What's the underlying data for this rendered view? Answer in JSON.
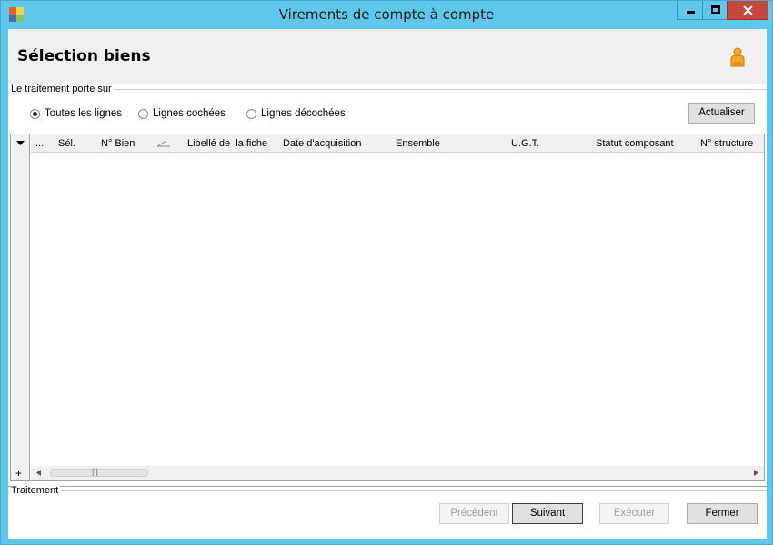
{
  "window": {
    "title": "Virements de compte à compte",
    "icons": {
      "app": "app-icon",
      "minimize": "minimize-icon",
      "maximize": "maximize-icon",
      "close": "close-icon"
    }
  },
  "header": {
    "title": "Sélection biens",
    "user_icon": "user-icon"
  },
  "filter": {
    "group_label": "Le traitement porte sur",
    "options": [
      {
        "label": "Toutes les lignes",
        "selected": true
      },
      {
        "label": "Lignes cochées",
        "selected": false
      },
      {
        "label": "Lignes décochées",
        "selected": false
      }
    ],
    "refresh_label": "Actualiser"
  },
  "grid": {
    "columns": [
      "...",
      "Sél.",
      "N° Bien",
      "Libellé de  la fiche",
      "Date d'acquisition",
      "Ensemble",
      "U.G.T.",
      "Statut composant",
      "N° structure"
    ],
    "rows": [],
    "add_glyph": "+",
    "thumb_glyph": "|||"
  },
  "footer": {
    "group_label": "Traitement",
    "buttons": {
      "previous": "Précédent",
      "next": "Suivant",
      "execute": "Exécuter",
      "close": "Fermer"
    }
  },
  "colors": {
    "titlebar": "#5ec8ec",
    "close_button": "#c7483b",
    "header_band": "#f0f0f0"
  }
}
